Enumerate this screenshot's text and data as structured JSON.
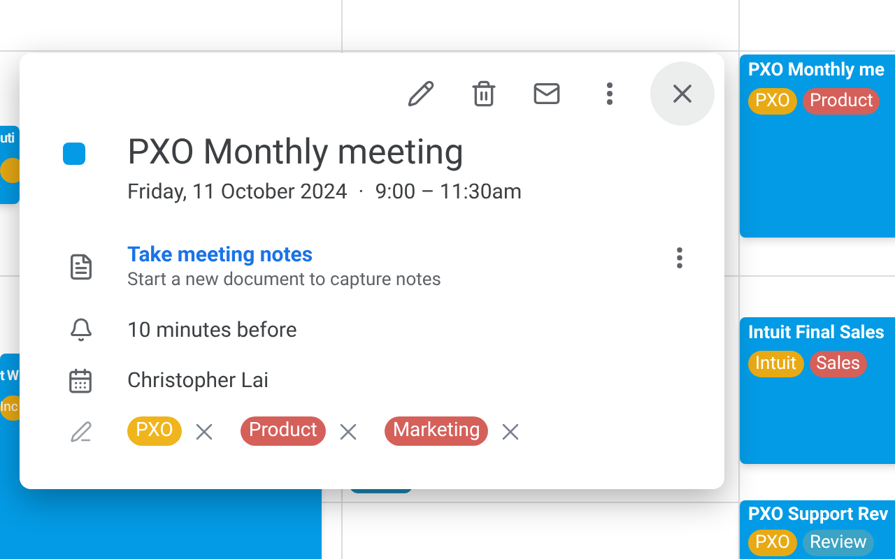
{
  "calendar": {
    "events": [
      {
        "title": "uti",
        "tags": [
          {
            "color": "#e8aa14"
          }
        ]
      },
      {
        "title": "t W",
        "tags": [
          {
            "label": "Inc",
            "color": "#e8aa14"
          }
        ]
      },
      {
        "title": "PXO Monthly me",
        "tags": [
          {
            "label": "PXO",
            "color": "#e8aa14"
          },
          {
            "label": "Product",
            "color": "#d5605a"
          }
        ]
      },
      {
        "title": "Intuit Final Sales",
        "tags": [
          {
            "label": "Intuit",
            "color": "#e8aa14"
          },
          {
            "label": "Sales",
            "color": "#d5605a"
          }
        ]
      },
      {
        "title": "PXO Support Rev",
        "tags": [
          {
            "label": "PXO",
            "color": "#e8aa14"
          },
          {
            "label": "Review",
            "color": "#3ba3c4"
          }
        ]
      }
    ]
  },
  "popover": {
    "color": "#039be5",
    "title": "PXO Monthly meeting",
    "date": "Friday, 11 October 2024",
    "separator": "·",
    "time": "9:00 – 11:30am",
    "notes": {
      "link": "Take meeting notes",
      "subtitle": "Start a new document to capture notes"
    },
    "reminder": "10 minutes before",
    "organizer": "Christopher Lai",
    "tags": [
      {
        "label": "PXO",
        "color": "#f0b41c"
      },
      {
        "label": "Product",
        "color": "#d5605a"
      },
      {
        "label": "Marketing",
        "color": "#d5605a"
      }
    ]
  }
}
